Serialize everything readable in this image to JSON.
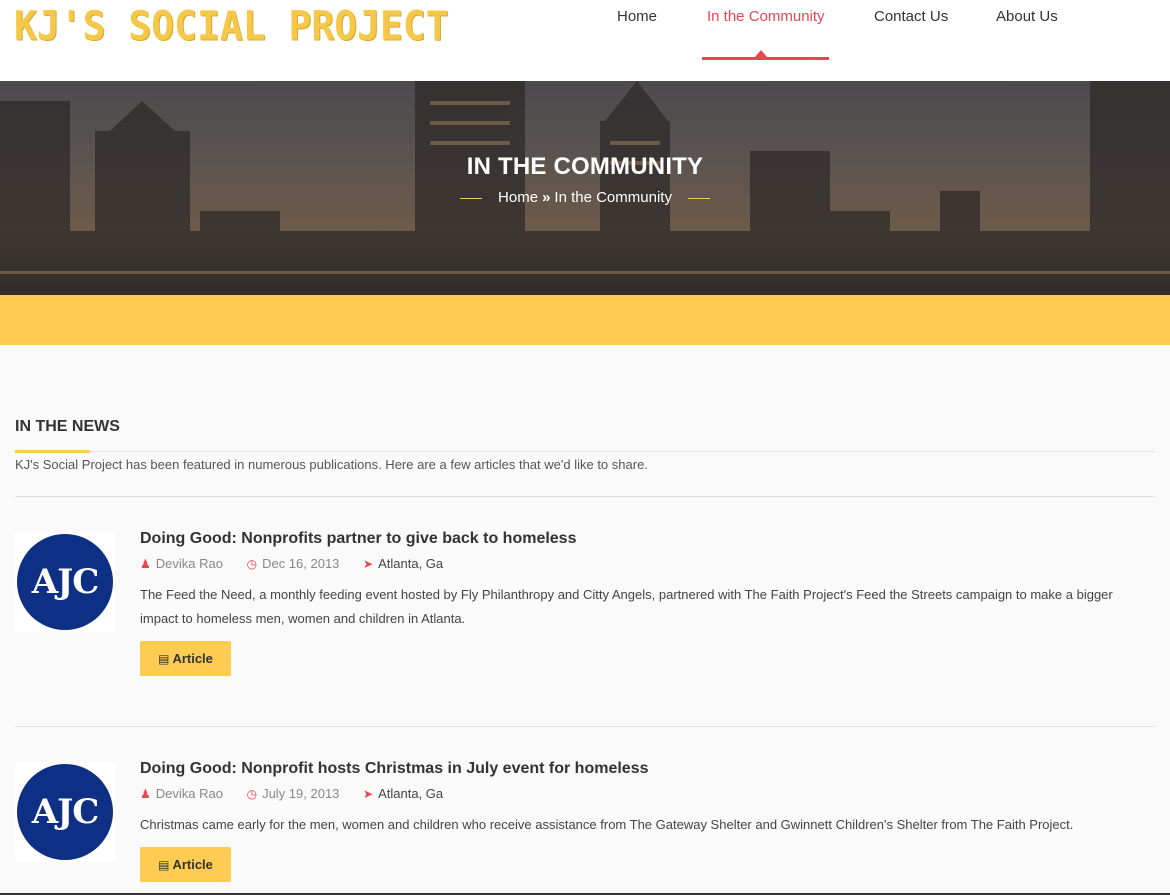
{
  "header": {
    "logo_text": "KJ'S SOCIAL PROJECT",
    "nav": [
      {
        "label": "Home",
        "active": false
      },
      {
        "label": "In the Community",
        "active": true
      },
      {
        "label": "Contact Us",
        "active": false
      },
      {
        "label": "About Us",
        "active": false
      }
    ]
  },
  "hero": {
    "title": "IN THE COMMUNITY",
    "breadcrumb": {
      "home": "Home",
      "separator": "»",
      "current": "In the Community"
    }
  },
  "news": {
    "title": "IN THE NEWS",
    "description": "KJ's Social Project has been featured in numerous publications. Here are a few articles that we'd like to share.",
    "articles": [
      {
        "logo_text": "AJC",
        "title": "Doing Good: Nonprofits partner to give back to homeless",
        "author": "Devika Rao",
        "date": "Dec 16, 2013",
        "location": "Atlanta, Ga",
        "summary": "The Feed the Need, a monthly feeding event hosted by Fly Philanthropy and Citty Angels, partnered with The Faith Project's Feed the Streets campaign to make a bigger impact to homeless men, women and children in Atlanta.",
        "button_label": "Article"
      },
      {
        "logo_text": "AJC",
        "title": "Doing Good: Nonprofit hosts Christmas in July event for homeless",
        "author": "Devika Rao",
        "date": "July 19, 2013",
        "location": "Atlanta, Ga",
        "summary": "Christmas came early for the men, women and children who receive assistance from The Gateway Shelter and Gwinnett Children's Shelter from The Faith Project.",
        "button_label": "Article"
      }
    ]
  },
  "colors": {
    "accent_red": "#e8474f",
    "accent_yellow": "#fecc50",
    "ajc_blue": "#0d2f84"
  }
}
